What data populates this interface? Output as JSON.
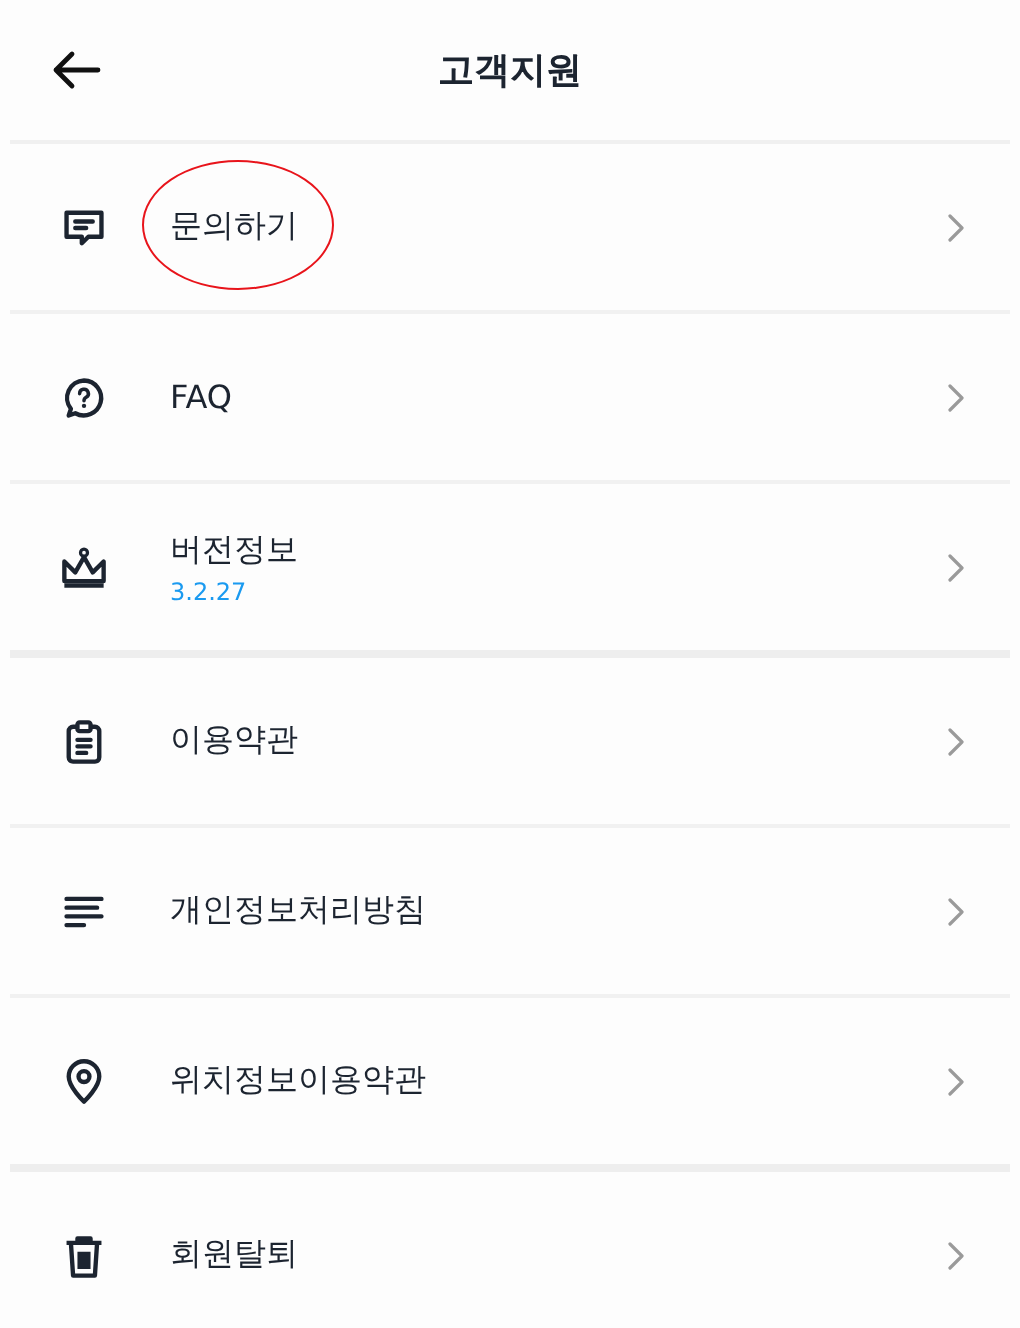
{
  "header": {
    "title": "고객지원"
  },
  "sections": [
    {
      "items": [
        {
          "label": "문의하기",
          "highlighted": true
        },
        {
          "label": "FAQ",
          "highlighted": false
        },
        {
          "label": "버전정보",
          "sublabel": "3.2.27",
          "highlighted": false
        }
      ]
    },
    {
      "items": [
        {
          "label": "이용약관",
          "highlighted": false
        },
        {
          "label": "개인정보처리방침",
          "highlighted": false
        },
        {
          "label": "위치정보이용약관",
          "highlighted": false
        }
      ]
    },
    {
      "items": [
        {
          "label": "회원탈퇴",
          "highlighted": false
        }
      ]
    }
  ]
}
